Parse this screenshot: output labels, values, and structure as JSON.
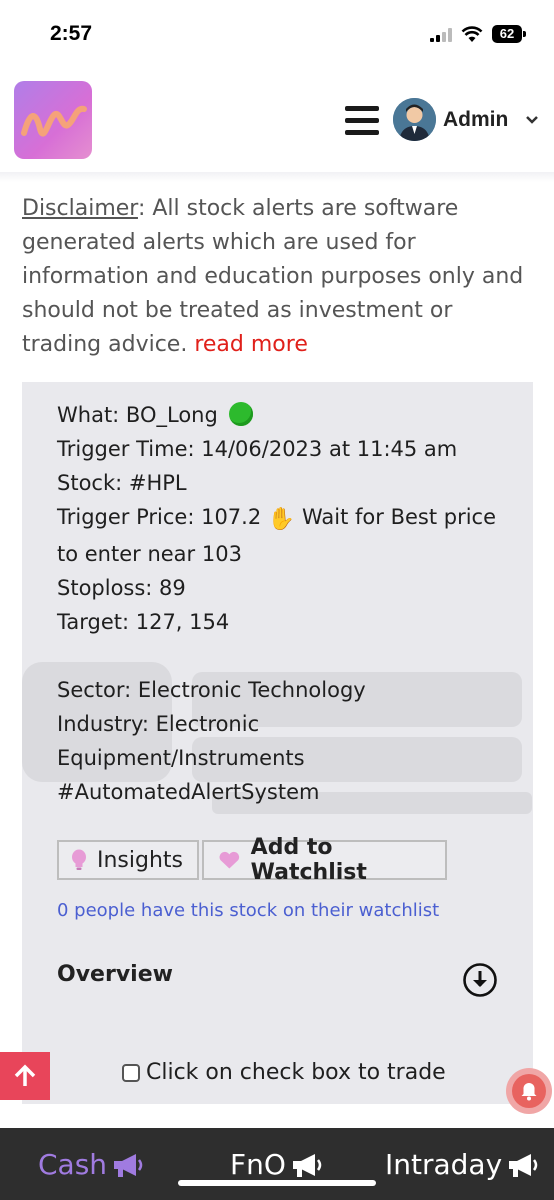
{
  "status_bar": {
    "time": "2:57",
    "battery": "62"
  },
  "header": {
    "user_name": "Admin"
  },
  "disclaimer": {
    "label": "Disclaimer",
    "text": ": All stock alerts are software generated alerts which are used for information and education purposes only and should not be treated as investment or trading advice. ",
    "read_more": "read more"
  },
  "alert": {
    "what": "What: BO_Long",
    "trigger_time": "Trigger Time: 14/06/2023 at 11:45 am",
    "stock": "Stock: #HPL",
    "trigger_price_a": "Trigger Price: 107.2",
    "trigger_price_b": "Wait for Best price to enter near 103",
    "stoploss": "Stoploss: 89",
    "target": "Target: 127, 154",
    "sector": "Sector: Electronic Technology",
    "industry": "Industry: Electronic Equipment/Instruments",
    "hashtag": "#AutomatedAlertSystem"
  },
  "buttons": {
    "insights": "Insights",
    "watchlist": "Add to Watchlist"
  },
  "watch_count_text": "0 people have this stock on their watchlist",
  "overview_label": "Overview",
  "trade_label": "Click on check box to trade",
  "bottom_tabs": {
    "cash": "Cash",
    "fno": "FnO",
    "intraday": "Intraday"
  },
  "colors": {
    "accent": "#a07be0",
    "link": "#4b5fd1",
    "read_more": "#e0201a",
    "scroll_top": "#e8455a"
  }
}
